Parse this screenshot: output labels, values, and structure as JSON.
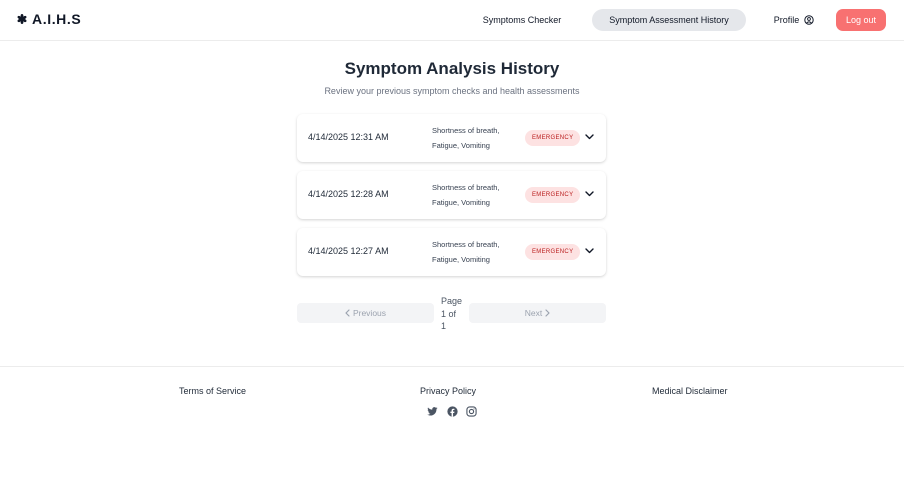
{
  "header": {
    "brand": "A.I.H.S",
    "brand_icon": "medical-asterisk-icon",
    "nav": {
      "symptoms_checker": "Symptoms Checker",
      "assessment_history": "Symptom Assessment History",
      "profile": "Profile"
    },
    "logout_label": "Log out"
  },
  "main": {
    "title": "Symptom Analysis History",
    "subtitle": "Review your previous symptom checks and health assessments",
    "entries": [
      {
        "date": "4/14/2025 12:31 AM",
        "symptoms_line1": "Shortness of breath,",
        "symptoms_line2": "Fatigue, Vomiting",
        "severity": "EMERGENCY"
      },
      {
        "date": "4/14/2025 12:28 AM",
        "symptoms_line1": "Shortness of breath,",
        "symptoms_line2": "Fatigue, Vomiting",
        "severity": "EMERGENCY"
      },
      {
        "date": "4/14/2025 12:27 AM",
        "symptoms_line1": "Shortness of breath,",
        "symptoms_line2": "Fatigue, Vomiting",
        "severity": "EMERGENCY"
      }
    ],
    "pagination": {
      "previous_label": "Previous",
      "next_label": "Next",
      "page_word": "Page",
      "page_of": "1 of",
      "total": "1"
    }
  },
  "footer": {
    "terms": "Terms of Service",
    "privacy": "Privacy Policy",
    "medical": "Medical Disclaimer",
    "social_icons": [
      "twitter-icon",
      "facebook-icon",
      "instagram-icon"
    ]
  },
  "colors": {
    "accent_logout": "#f87171",
    "badge_bg": "#fde2e2",
    "badge_text": "#b91c1c",
    "active_nav_bg": "#e5e7eb"
  }
}
